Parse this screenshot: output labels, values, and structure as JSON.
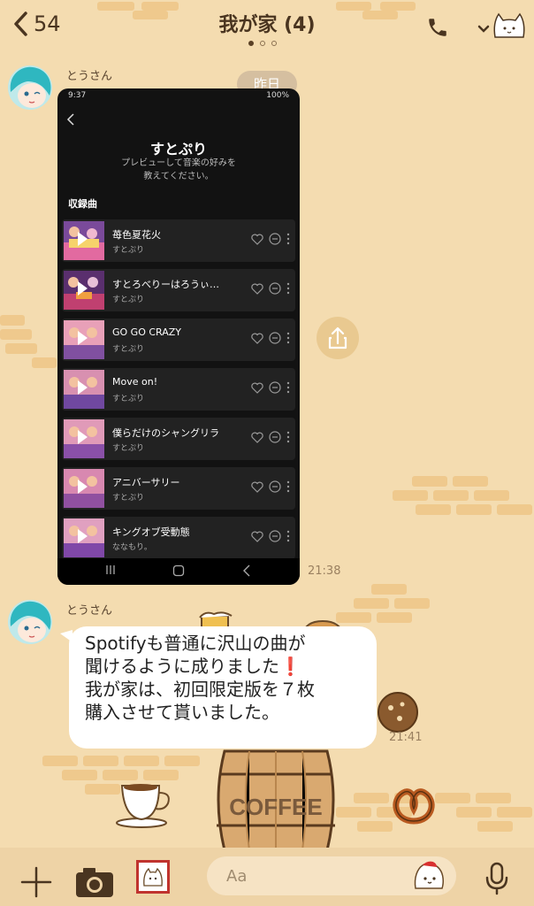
{
  "header": {
    "back_count": "54",
    "title": "我が家 (4)"
  },
  "messages": [
    {
      "sender": "とうさん",
      "date_label": "昨日",
      "time": "21:38",
      "screenshot": {
        "status_time": "9:37",
        "status_right": "100%",
        "artist_title": "すとぷり",
        "subtitle": "プレビューして音楽の好みを\n教えてください。",
        "section": "収録曲",
        "tracks": [
          {
            "name": "苺色夏花火",
            "artist": "すとぷり"
          },
          {
            "name": "すとろべりーはろうぃ…",
            "artist": "すとぷり"
          },
          {
            "name": "GO GO CRAZY",
            "artist": "すとぷり"
          },
          {
            "name": "Move on!",
            "artist": "すとぷり"
          },
          {
            "name": "僕らだけのシャングリラ",
            "artist": "すとぷり"
          },
          {
            "name": "アニバーサリー",
            "artist": "すとぷり"
          },
          {
            "name": "キングオブ受動態",
            "artist": "ななもり。"
          }
        ]
      }
    },
    {
      "sender": "とうさん",
      "time": "21:41",
      "text": "Spotifyも普通に沢山の曲が\n聞けるように成りました❗\n我が家は、初回限定版を７枚\n購入させて貰いました。"
    }
  ],
  "decor": {
    "barrel_label": "COFFEE"
  },
  "composer": {
    "placeholder": "Aa"
  },
  "colors": {
    "background": "#f4dcb0",
    "brick": "#efc98d",
    "bubble": "#ffffff",
    "text_brown": "#4a3520"
  },
  "icons": [
    "chevron-left-icon",
    "phone-icon",
    "chevron-down-icon",
    "cat-icon",
    "share-icon",
    "plus-icon",
    "camera-icon",
    "sticker-icon",
    "emoji-icon",
    "mic-icon"
  ]
}
